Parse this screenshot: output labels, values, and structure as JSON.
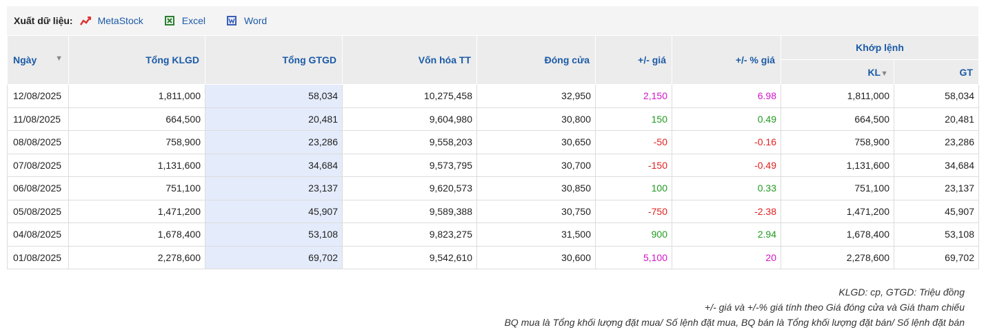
{
  "export": {
    "label": "Xuất dữ liệu:",
    "metastock": "MetaStock",
    "excel": "Excel",
    "word": "Word"
  },
  "headers": {
    "date": "Ngày",
    "tong_klgd": "Tổng KLGD",
    "tong_gtgd": "Tổng GTGD",
    "von_hoa": "Vốn hóa TT",
    "dong_cua": "Đóng cửa",
    "change": "+/- giá",
    "change_pct": "+/- % giá",
    "khop_lenh": "Khớp lệnh",
    "kl": "KL",
    "gt": "GT"
  },
  "rows": [
    {
      "date": "12/08/2025",
      "klgd": "1,811,000",
      "gtgd": "58,034",
      "vonhoa": "10,275,458",
      "close": "32,950",
      "chg": "2,150",
      "pct": "6.98",
      "kl": "1,811,000",
      "gt": "58,034",
      "dir": "ceil"
    },
    {
      "date": "11/08/2025",
      "klgd": "664,500",
      "gtgd": "20,481",
      "vonhoa": "9,604,980",
      "close": "30,800",
      "chg": "150",
      "pct": "0.49",
      "kl": "664,500",
      "gt": "20,481",
      "dir": "up"
    },
    {
      "date": "08/08/2025",
      "klgd": "758,900",
      "gtgd": "23,286",
      "vonhoa": "9,558,203",
      "close": "30,650",
      "chg": "-50",
      "pct": "-0.16",
      "kl": "758,900",
      "gt": "23,286",
      "dir": "down"
    },
    {
      "date": "07/08/2025",
      "klgd": "1,131,600",
      "gtgd": "34,684",
      "vonhoa": "9,573,795",
      "close": "30,700",
      "chg": "-150",
      "pct": "-0.49",
      "kl": "1,131,600",
      "gt": "34,684",
      "dir": "down"
    },
    {
      "date": "06/08/2025",
      "klgd": "751,100",
      "gtgd": "23,137",
      "vonhoa": "9,620,573",
      "close": "30,850",
      "chg": "100",
      "pct": "0.33",
      "kl": "751,100",
      "gt": "23,137",
      "dir": "up"
    },
    {
      "date": "05/08/2025",
      "klgd": "1,471,200",
      "gtgd": "45,907",
      "vonhoa": "9,589,388",
      "close": "30,750",
      "chg": "-750",
      "pct": "-2.38",
      "kl": "1,471,200",
      "gt": "45,907",
      "dir": "down"
    },
    {
      "date": "04/08/2025",
      "klgd": "1,678,400",
      "gtgd": "53,108",
      "vonhoa": "9,823,275",
      "close": "31,500",
      "chg": "900",
      "pct": "2.94",
      "kl": "1,678,400",
      "gt": "53,108",
      "dir": "up"
    },
    {
      "date": "01/08/2025",
      "klgd": "2,278,600",
      "gtgd": "69,702",
      "vonhoa": "9,542,610",
      "close": "30,600",
      "chg": "5,100",
      "pct": "20",
      "kl": "2,278,600",
      "gt": "69,702",
      "dir": "ceil"
    }
  ],
  "notes": [
    "KLGD: cp, GTGD: Triệu đồng",
    "+/- giá và +/-% giá tính theo Giá đóng cửa và Giá tham chiếu",
    "BQ mua là Tổng khối lượng đặt mua/ Số lệnh đặt mua, BQ bán là Tổng khối lượng đặt bán/ Số lệnh đặt bán"
  ],
  "colors": {
    "up": "#1f9a1f",
    "down": "#e0201f",
    "ceil": "#d214c8",
    "link": "#1b5aa6"
  }
}
